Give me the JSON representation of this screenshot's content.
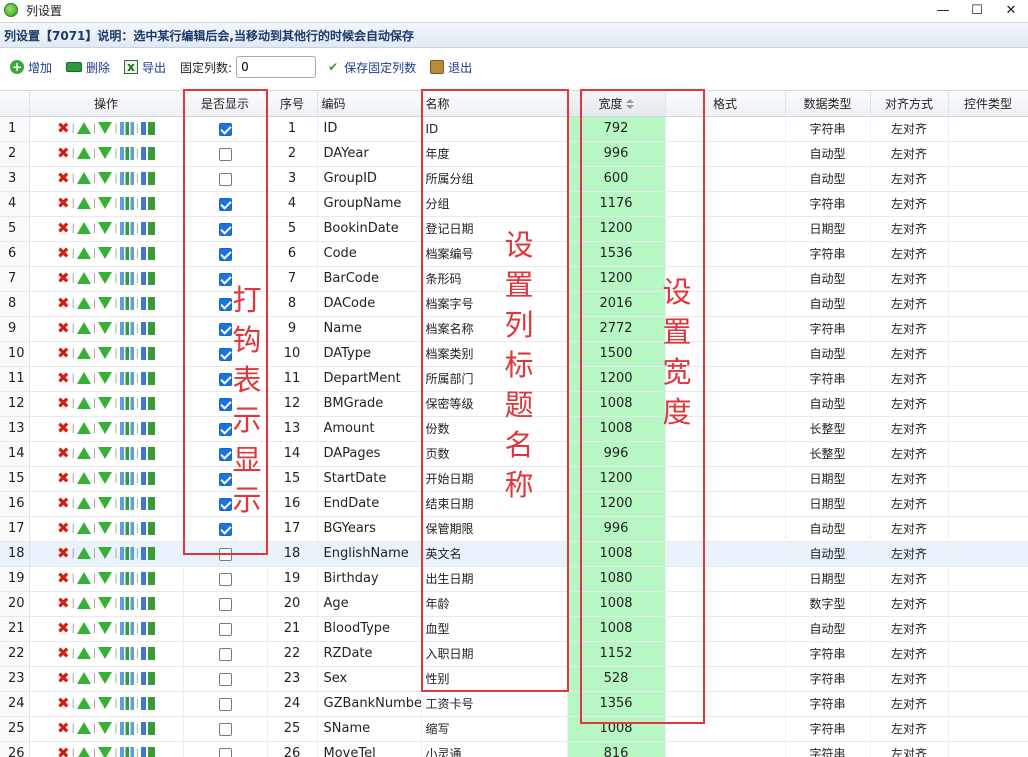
{
  "window": {
    "title": "列设置",
    "minimize": "—",
    "maximize": "☐",
    "close": "✕"
  },
  "infobar": {
    "text": "列设置【7071】说明：选中某行编辑后会,当移动到其他行的时候会自动保存"
  },
  "toolbar": {
    "add_label": "增加",
    "delete_label": "删除",
    "export_label": "导出",
    "fixed_cols_label": "固定列数:",
    "fixed_cols_value": "0",
    "save_fixed_label": "保存固定列数",
    "exit_label": "退出"
  },
  "columns": {
    "ops": "操作",
    "show": "是否显示",
    "seq": "序号",
    "code": "编码",
    "name": "名称",
    "width": "宽度",
    "format": "格式",
    "dtype": "数据类型",
    "align": "对齐方式",
    "ctrl": "控件类型"
  },
  "rows": [
    {
      "n": "1",
      "show": true,
      "seq": "1",
      "code": "ID",
      "name": "ID",
      "width": "792",
      "dtype": "字符串",
      "align": "左对齐"
    },
    {
      "n": "2",
      "show": false,
      "seq": "2",
      "code": "DAYear",
      "name": "年度",
      "width": "996",
      "dtype": "自动型",
      "align": "左对齐"
    },
    {
      "n": "3",
      "show": false,
      "seq": "3",
      "code": "GroupID",
      "name": "所属分组",
      "width": "600",
      "dtype": "自动型",
      "align": "左对齐"
    },
    {
      "n": "4",
      "show": true,
      "seq": "4",
      "code": "GroupName",
      "name": "分组",
      "width": "1176",
      "dtype": "字符串",
      "align": "左对齐"
    },
    {
      "n": "5",
      "show": true,
      "seq": "5",
      "code": "BookinDate",
      "name": "登记日期",
      "width": "1200",
      "dtype": "日期型",
      "align": "左对齐"
    },
    {
      "n": "6",
      "show": true,
      "seq": "6",
      "code": "Code",
      "name": "档案编号",
      "width": "1536",
      "dtype": "字符串",
      "align": "左对齐"
    },
    {
      "n": "7",
      "show": true,
      "seq": "7",
      "code": "BarCode",
      "name": "条形码",
      "width": "1200",
      "dtype": "自动型",
      "align": "左对齐"
    },
    {
      "n": "8",
      "show": true,
      "seq": "8",
      "code": "DACode",
      "name": "档案字号",
      "width": "2016",
      "dtype": "自动型",
      "align": "左对齐"
    },
    {
      "n": "9",
      "show": true,
      "seq": "9",
      "code": "Name",
      "name": "档案名称",
      "width": "2772",
      "dtype": "字符串",
      "align": "左对齐"
    },
    {
      "n": "10",
      "show": true,
      "seq": "10",
      "code": "DAType",
      "name": "档案类别",
      "width": "1500",
      "dtype": "自动型",
      "align": "左对齐"
    },
    {
      "n": "11",
      "show": true,
      "seq": "11",
      "code": "DepartMent",
      "name": "所属部门",
      "width": "1200",
      "dtype": "字符串",
      "align": "左对齐"
    },
    {
      "n": "12",
      "show": true,
      "seq": "12",
      "code": "BMGrade",
      "name": "保密等级",
      "width": "1008",
      "dtype": "自动型",
      "align": "左对齐"
    },
    {
      "n": "13",
      "show": true,
      "seq": "13",
      "code": "Amount",
      "name": "份数",
      "width": "1008",
      "dtype": "长整型",
      "align": "左对齐"
    },
    {
      "n": "14",
      "show": true,
      "seq": "14",
      "code": "DAPages",
      "name": "页数",
      "width": "996",
      "dtype": "长整型",
      "align": "左对齐"
    },
    {
      "n": "15",
      "show": true,
      "seq": "15",
      "code": "StartDate",
      "name": "开始日期",
      "width": "1200",
      "dtype": "日期型",
      "align": "左对齐"
    },
    {
      "n": "16",
      "show": true,
      "seq": "16",
      "code": "EndDate",
      "name": "结束日期",
      "width": "1200",
      "dtype": "日期型",
      "align": "左对齐"
    },
    {
      "n": "17",
      "show": true,
      "seq": "17",
      "code": "BGYears",
      "name": "保管期限",
      "width": "996",
      "dtype": "自动型",
      "align": "左对齐"
    },
    {
      "n": "18",
      "show": false,
      "seq": "18",
      "code": "EnglishName",
      "name": "英文名",
      "width": "1008",
      "dtype": "自动型",
      "align": "左对齐",
      "selected": true
    },
    {
      "n": "19",
      "show": false,
      "seq": "19",
      "code": "Birthday",
      "name": "出生日期",
      "width": "1080",
      "dtype": "日期型",
      "align": "左对齐"
    },
    {
      "n": "20",
      "show": false,
      "seq": "20",
      "code": "Age",
      "name": "年龄",
      "width": "1008",
      "dtype": "数字型",
      "align": "左对齐"
    },
    {
      "n": "21",
      "show": false,
      "seq": "21",
      "code": "BloodType",
      "name": "血型",
      "width": "1008",
      "dtype": "自动型",
      "align": "左对齐"
    },
    {
      "n": "22",
      "show": false,
      "seq": "22",
      "code": "RZDate",
      "name": "入职日期",
      "width": "1152",
      "dtype": "字符串",
      "align": "左对齐"
    },
    {
      "n": "23",
      "show": false,
      "seq": "23",
      "code": "Sex",
      "name": "性别",
      "width": "528",
      "dtype": "字符串",
      "align": "左对齐"
    },
    {
      "n": "24",
      "show": false,
      "seq": "24",
      "code": "GZBankNumber",
      "name": "工资卡号",
      "width": "1356",
      "dtype": "字符串",
      "align": "左对齐"
    },
    {
      "n": "25",
      "show": false,
      "seq": "25",
      "code": "SName",
      "name": "缩写",
      "width": "1008",
      "dtype": "字符串",
      "align": "左对齐"
    },
    {
      "n": "26",
      "show": false,
      "seq": "26",
      "code": "MoveTel",
      "name": "小灵通",
      "width": "816",
      "dtype": "字符串",
      "align": "左对齐"
    }
  ],
  "annotations": {
    "show_note": "打钩表示显示",
    "title_note": "设置列标题名称",
    "width_note": "设置宽度"
  },
  "colors": {
    "annotation_red": "#e0363c",
    "width_highlight": "#b7f7c3",
    "checkbox_blue": "#1a74e0"
  }
}
